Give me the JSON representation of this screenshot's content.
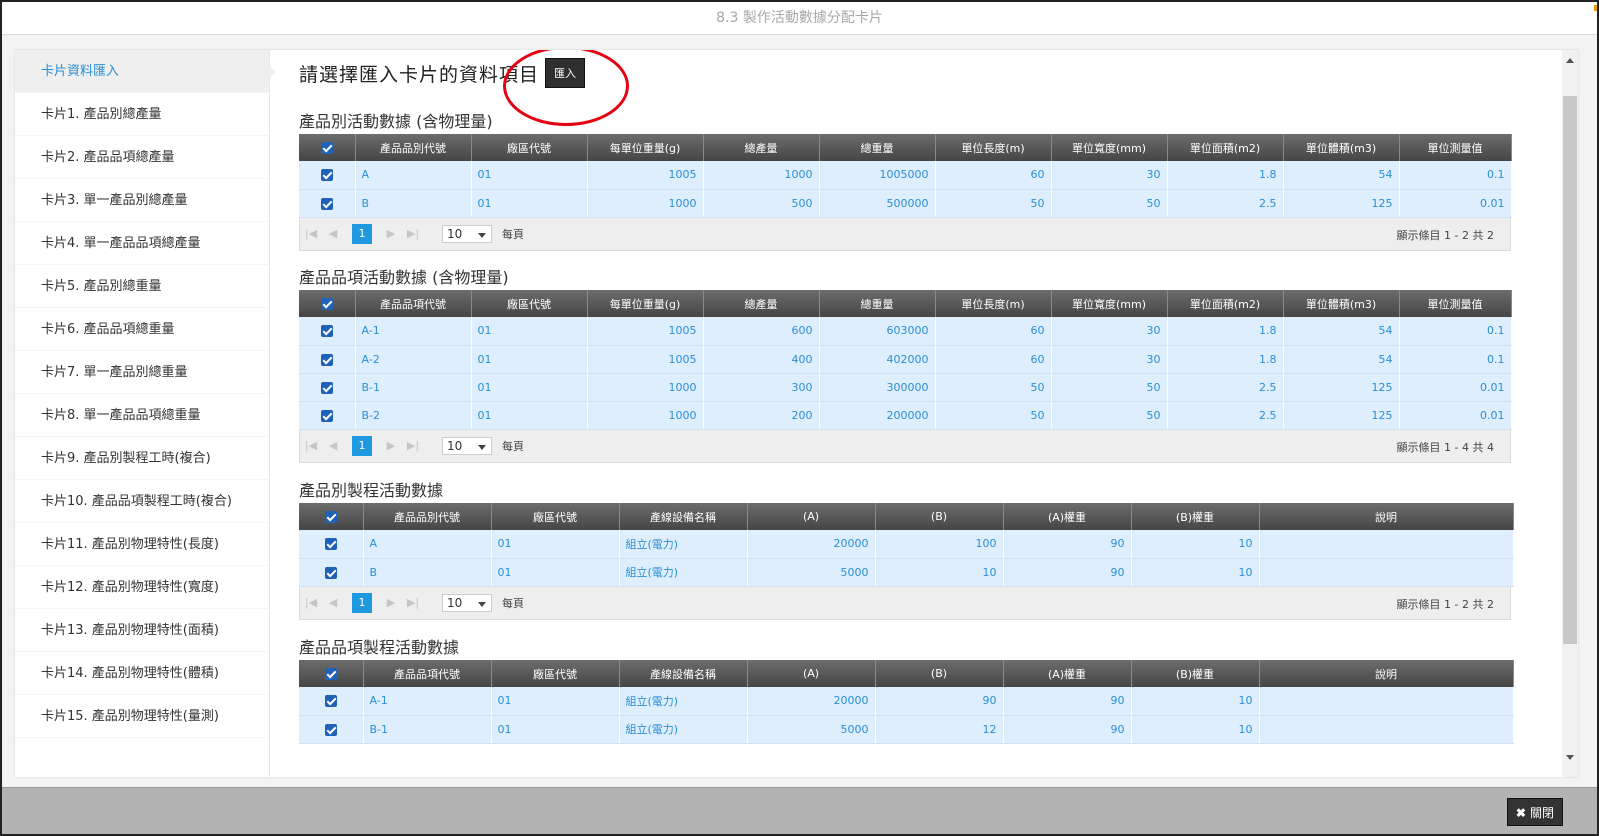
{
  "window": {
    "title": "8.3 製作活動數據分配卡片"
  },
  "sidebar": {
    "items": [
      {
        "label": "卡片資料匯入",
        "active": true
      },
      {
        "label": "卡片1. 產品別總產量"
      },
      {
        "label": "卡片2. 產品品項總產量"
      },
      {
        "label": "卡片3. 單一產品別總產量"
      },
      {
        "label": "卡片4. 單一產品品項總產量"
      },
      {
        "label": "卡片5. 產品別總重量"
      },
      {
        "label": "卡片6. 產品品項總重量"
      },
      {
        "label": "卡片7. 單一產品別總重量"
      },
      {
        "label": "卡片8. 單一產品品項總重量"
      },
      {
        "label": "卡片9. 產品別製程工時(複合)"
      },
      {
        "label": "卡片10. 產品品項製程工時(複合)"
      },
      {
        "label": "卡片11. 產品別物理特性(長度)"
      },
      {
        "label": "卡片12. 產品別物理特性(寬度)"
      },
      {
        "label": "卡片13. 產品別物理特性(面積)"
      },
      {
        "label": "卡片14. 產品別物理特性(體積)"
      },
      {
        "label": "卡片15. 產品別物理特性(量測)"
      }
    ]
  },
  "main": {
    "title": "請選擇匯入卡片的資料項目",
    "import_label": "匯入",
    "sections": [
      {
        "title": "產品別活動數據 (含物理量)",
        "columns": [
          "產品品別代號",
          "廠區代號",
          "每單位重量(g)",
          "總產量",
          "總重量",
          "單位長度(m)",
          "單位寬度(mm)",
          "單位面積(m2)",
          "單位體積(m3)",
          "單位測量值"
        ],
        "rows": [
          [
            "A",
            "01",
            "1005",
            "1000",
            "1005000",
            "60",
            "30",
            "1.8",
            "54",
            "0.1"
          ],
          [
            "B",
            "01",
            "1000",
            "500",
            "500000",
            "50",
            "50",
            "2.5",
            "125",
            "0.01"
          ]
        ],
        "pager": {
          "page": "1",
          "size": "10",
          "per_page": "每頁",
          "info": "顯示條目 1 - 2 共 2"
        }
      },
      {
        "title": "產品品項活動數據 (含物理量)",
        "columns": [
          "產品品項代號",
          "廠區代號",
          "每單位重量(g)",
          "總產量",
          "總重量",
          "單位長度(m)",
          "單位寬度(mm)",
          "單位面積(m2)",
          "單位體積(m3)",
          "單位測量值"
        ],
        "rows": [
          [
            "A-1",
            "01",
            "1005",
            "600",
            "603000",
            "60",
            "30",
            "1.8",
            "54",
            "0.1"
          ],
          [
            "A-2",
            "01",
            "1005",
            "400",
            "402000",
            "60",
            "30",
            "1.8",
            "54",
            "0.1"
          ],
          [
            "B-1",
            "01",
            "1000",
            "300",
            "300000",
            "50",
            "50",
            "2.5",
            "125",
            "0.01"
          ],
          [
            "B-2",
            "01",
            "1000",
            "200",
            "200000",
            "50",
            "50",
            "2.5",
            "125",
            "0.01"
          ]
        ],
        "pager": {
          "page": "1",
          "size": "10",
          "per_page": "每頁",
          "info": "顯示條目 1 - 4 共 4"
        }
      },
      {
        "title": "產品別製程活動數據",
        "columns": [
          "產品品別代號",
          "廠區代號",
          "產線設備名稱",
          "(A)",
          "(B)",
          "(A)權重",
          "(B)權重",
          "說明"
        ],
        "rows": [
          [
            "A",
            "01",
            "組立(電力)",
            "20000",
            "100",
            "90",
            "10",
            ""
          ],
          [
            "B",
            "01",
            "組立(電力)",
            "5000",
            "10",
            "90",
            "10",
            ""
          ]
        ],
        "pager": {
          "page": "1",
          "size": "10",
          "per_page": "每頁",
          "info": "顯示條目 1 - 2 共 2"
        }
      },
      {
        "title": "產品品項製程活動數據",
        "columns": [
          "產品品項代號",
          "廠區代號",
          "產線設備名稱",
          "(A)",
          "(B)",
          "(A)權重",
          "(B)權重",
          "說明"
        ],
        "rows": [
          [
            "A-1",
            "01",
            "組立(電力)",
            "20000",
            "90",
            "90",
            "10",
            ""
          ],
          [
            "B-1",
            "01",
            "組立(電力)",
            "5000",
            "12",
            "90",
            "10",
            ""
          ]
        ]
      }
    ]
  },
  "footer": {
    "close_label": "關閉"
  }
}
